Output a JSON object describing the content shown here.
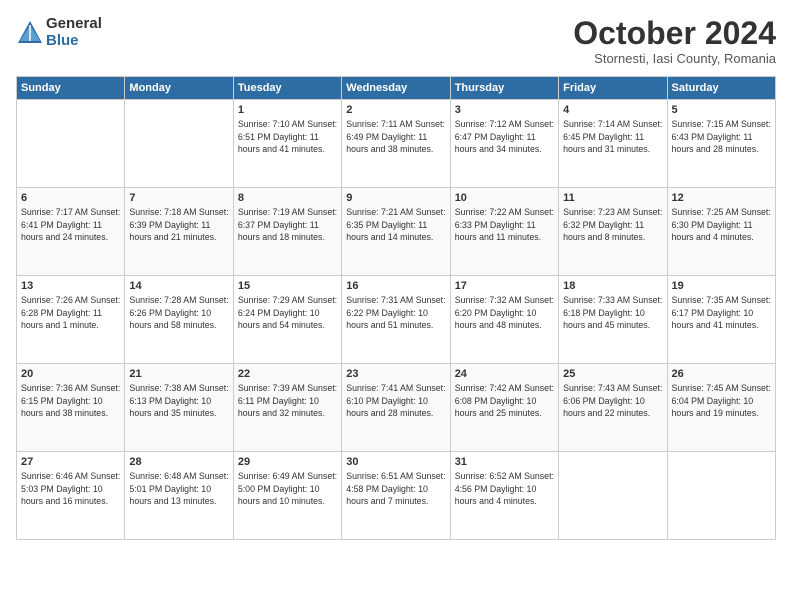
{
  "logo": {
    "general": "General",
    "blue": "Blue"
  },
  "title": "October 2024",
  "location": "Stornesti, Iasi County, Romania",
  "headers": [
    "Sunday",
    "Monday",
    "Tuesday",
    "Wednesday",
    "Thursday",
    "Friday",
    "Saturday"
  ],
  "weeks": [
    [
      {
        "day": "",
        "info": ""
      },
      {
        "day": "",
        "info": ""
      },
      {
        "day": "1",
        "info": "Sunrise: 7:10 AM\nSunset: 6:51 PM\nDaylight: 11 hours\nand 41 minutes."
      },
      {
        "day": "2",
        "info": "Sunrise: 7:11 AM\nSunset: 6:49 PM\nDaylight: 11 hours\nand 38 minutes."
      },
      {
        "day": "3",
        "info": "Sunrise: 7:12 AM\nSunset: 6:47 PM\nDaylight: 11 hours\nand 34 minutes."
      },
      {
        "day": "4",
        "info": "Sunrise: 7:14 AM\nSunset: 6:45 PM\nDaylight: 11 hours\nand 31 minutes."
      },
      {
        "day": "5",
        "info": "Sunrise: 7:15 AM\nSunset: 6:43 PM\nDaylight: 11 hours\nand 28 minutes."
      }
    ],
    [
      {
        "day": "6",
        "info": "Sunrise: 7:17 AM\nSunset: 6:41 PM\nDaylight: 11 hours\nand 24 minutes."
      },
      {
        "day": "7",
        "info": "Sunrise: 7:18 AM\nSunset: 6:39 PM\nDaylight: 11 hours\nand 21 minutes."
      },
      {
        "day": "8",
        "info": "Sunrise: 7:19 AM\nSunset: 6:37 PM\nDaylight: 11 hours\nand 18 minutes."
      },
      {
        "day": "9",
        "info": "Sunrise: 7:21 AM\nSunset: 6:35 PM\nDaylight: 11 hours\nand 14 minutes."
      },
      {
        "day": "10",
        "info": "Sunrise: 7:22 AM\nSunset: 6:33 PM\nDaylight: 11 hours\nand 11 minutes."
      },
      {
        "day": "11",
        "info": "Sunrise: 7:23 AM\nSunset: 6:32 PM\nDaylight: 11 hours\nand 8 minutes."
      },
      {
        "day": "12",
        "info": "Sunrise: 7:25 AM\nSunset: 6:30 PM\nDaylight: 11 hours\nand 4 minutes."
      }
    ],
    [
      {
        "day": "13",
        "info": "Sunrise: 7:26 AM\nSunset: 6:28 PM\nDaylight: 11 hours\nand 1 minute."
      },
      {
        "day": "14",
        "info": "Sunrise: 7:28 AM\nSunset: 6:26 PM\nDaylight: 10 hours\nand 58 minutes."
      },
      {
        "day": "15",
        "info": "Sunrise: 7:29 AM\nSunset: 6:24 PM\nDaylight: 10 hours\nand 54 minutes."
      },
      {
        "day": "16",
        "info": "Sunrise: 7:31 AM\nSunset: 6:22 PM\nDaylight: 10 hours\nand 51 minutes."
      },
      {
        "day": "17",
        "info": "Sunrise: 7:32 AM\nSunset: 6:20 PM\nDaylight: 10 hours\nand 48 minutes."
      },
      {
        "day": "18",
        "info": "Sunrise: 7:33 AM\nSunset: 6:18 PM\nDaylight: 10 hours\nand 45 minutes."
      },
      {
        "day": "19",
        "info": "Sunrise: 7:35 AM\nSunset: 6:17 PM\nDaylight: 10 hours\nand 41 minutes."
      }
    ],
    [
      {
        "day": "20",
        "info": "Sunrise: 7:36 AM\nSunset: 6:15 PM\nDaylight: 10 hours\nand 38 minutes."
      },
      {
        "day": "21",
        "info": "Sunrise: 7:38 AM\nSunset: 6:13 PM\nDaylight: 10 hours\nand 35 minutes."
      },
      {
        "day": "22",
        "info": "Sunrise: 7:39 AM\nSunset: 6:11 PM\nDaylight: 10 hours\nand 32 minutes."
      },
      {
        "day": "23",
        "info": "Sunrise: 7:41 AM\nSunset: 6:10 PM\nDaylight: 10 hours\nand 28 minutes."
      },
      {
        "day": "24",
        "info": "Sunrise: 7:42 AM\nSunset: 6:08 PM\nDaylight: 10 hours\nand 25 minutes."
      },
      {
        "day": "25",
        "info": "Sunrise: 7:43 AM\nSunset: 6:06 PM\nDaylight: 10 hours\nand 22 minutes."
      },
      {
        "day": "26",
        "info": "Sunrise: 7:45 AM\nSunset: 6:04 PM\nDaylight: 10 hours\nand 19 minutes."
      }
    ],
    [
      {
        "day": "27",
        "info": "Sunrise: 6:46 AM\nSunset: 5:03 PM\nDaylight: 10 hours\nand 16 minutes."
      },
      {
        "day": "28",
        "info": "Sunrise: 6:48 AM\nSunset: 5:01 PM\nDaylight: 10 hours\nand 13 minutes."
      },
      {
        "day": "29",
        "info": "Sunrise: 6:49 AM\nSunset: 5:00 PM\nDaylight: 10 hours\nand 10 minutes."
      },
      {
        "day": "30",
        "info": "Sunrise: 6:51 AM\nSunset: 4:58 PM\nDaylight: 10 hours\nand 7 minutes."
      },
      {
        "day": "31",
        "info": "Sunrise: 6:52 AM\nSunset: 4:56 PM\nDaylight: 10 hours\nand 4 minutes."
      },
      {
        "day": "",
        "info": ""
      },
      {
        "day": "",
        "info": ""
      }
    ]
  ]
}
